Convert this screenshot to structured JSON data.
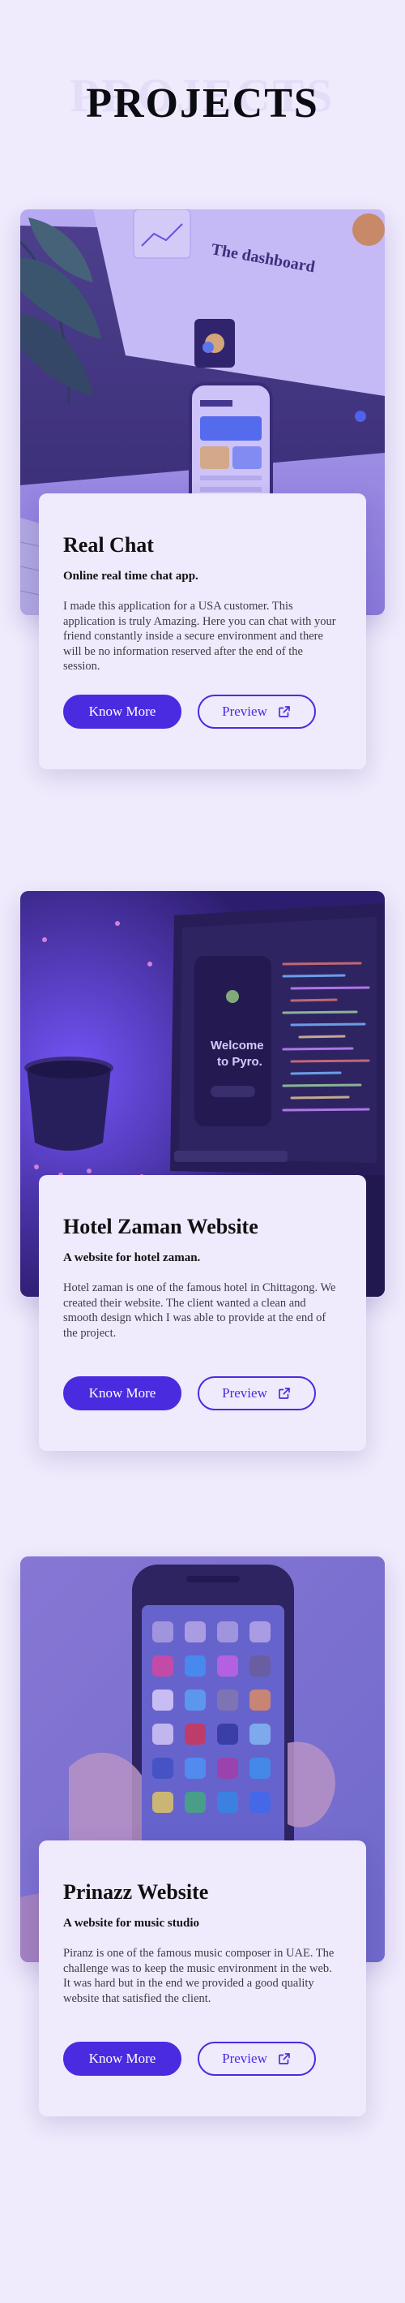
{
  "header": {
    "title": "PROJECTS",
    "title_shadow": "PROJECTS"
  },
  "projects": [
    {
      "image_alt": "Real Chat preview - dashboard app on phone and monitor",
      "title": "Real Chat",
      "subtitle": "Online real time chat app.",
      "description": "I made this application for a USA customer. This application is truly Amazing. Here you can chat with your friend constantly inside a secure environment and there will be no information reserved after the end of the session.",
      "primary_label": "Know More",
      "secondary_label": "Preview"
    },
    {
      "image_alt": "Hotel Zaman Website preview - laptop with code editor",
      "title": "Hotel Zaman Website",
      "subtitle": "A website for hotel zaman.",
      "description": "Hotel zaman is one of the famous hotel in Chittagong. We created their website. The client wanted a clean and smooth design which I was able to provide at the end of the project.",
      "primary_label": "Know More",
      "secondary_label": "Preview"
    },
    {
      "image_alt": "Prinazz Website preview - hand holding a smartphone",
      "title": "Prinazz Website",
      "subtitle": "A website for music studio",
      "description": "Piranz is one of the famous music composer in UAE. The challenge was to keep the music environment in the web. It was hard but in the end we provided a good quality website that satisfied the client.",
      "primary_label": "Know More",
      "secondary_label": "Preview"
    }
  ],
  "colors": {
    "background": "#efeafc",
    "accent": "#4a2be0",
    "text": "#111111",
    "muted_text": "#3c3c46"
  },
  "icons": {
    "preview": "external-link-icon"
  }
}
